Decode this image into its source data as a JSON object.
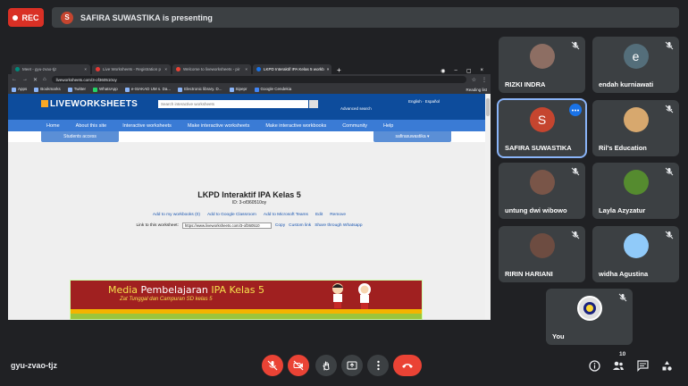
{
  "top": {
    "rec_label": "REC",
    "presenter_initial": "S",
    "presenting_text": "SAFIRA SUWASTIKA is presenting"
  },
  "browser": {
    "tabs": [
      {
        "label": "Meet - gyu-zvao-tjz",
        "color": "#00897b"
      },
      {
        "label": "Live Worksheets - Registration p",
        "color": "#e53935"
      },
      {
        "label": "Welcome to liveworksheets - pir",
        "color": "#ea4335"
      },
      {
        "label": "LKPD Interaktif IPA Kelas 5 workb",
        "color": "#1a73e8"
      }
    ],
    "url": "liveworksheets.com/3-of360510oy",
    "bookmarks": [
      "Apps",
      "Bookmarks",
      "Twitter",
      "WhatsApp",
      "e-SIAKAD UM s. Da...",
      "Electronic library. D...",
      "Sipepr",
      "Google Cendekia"
    ],
    "reading_list": "Reading list"
  },
  "site": {
    "logo": "LIVEWORKSHEETS",
    "search_placeholder": "Search interactive worksheets",
    "advanced_search": "Advanced search",
    "lang": "English · Español",
    "nav": [
      "Home",
      "About this site",
      "Interactive worksheets",
      "Make interactive worksheets",
      "Make interactive workbooks",
      "Community",
      "Help"
    ],
    "students_access": "Students access",
    "user_menu": "safirasuwastika ▾",
    "title": "LKPD Interaktif IPA Kelas 5",
    "id_line": "ID: 3-of360510oy",
    "actions": [
      "Add to my workbooks (0)",
      "Add to Google Classroom",
      "Add to Microsoft Teams",
      "Edit",
      "Remove"
    ],
    "link_label": "Link to this worksheet:",
    "link_value": "https://www.liveworksheets.com/3-of360510",
    "link_actions": [
      "Copy",
      "Custom link",
      "Share through Whatsapp"
    ],
    "banner_title_a": "Media",
    "banner_title_b": "Pembelajaran",
    "banner_title_c": "IPA Kelas 5",
    "banner_subtitle": "Zat Tunggal dan Campuran SD kelas 5"
  },
  "participants": [
    {
      "name": "RIZKI INDRA",
      "type": "photo",
      "color": "#8d6e63"
    },
    {
      "name": "endah kurniawati",
      "type": "initial",
      "initial": "e",
      "color": "#546e7a"
    },
    {
      "name": "SAFIRA SUWASTIKA",
      "type": "initial",
      "initial": "S",
      "color": "#c5452f"
    },
    {
      "name": "Ril's Education",
      "type": "photo",
      "color": "#d7a86e"
    },
    {
      "name": "untung dwi wibowo",
      "type": "photo",
      "color": "#795548"
    },
    {
      "name": "Layla Azyzatur",
      "type": "photo",
      "color": "#558b2f"
    },
    {
      "name": "RIRIN HARIANI",
      "type": "photo",
      "color": "#6d4c41"
    },
    {
      "name": "widha Agustina",
      "type": "photo",
      "color": "#90caf9"
    },
    {
      "name": "You",
      "type": "photo",
      "color": "#e0e0e0"
    }
  ],
  "bottom": {
    "meeting_code": "gyu-zvao-tjz",
    "participant_count": "10"
  }
}
